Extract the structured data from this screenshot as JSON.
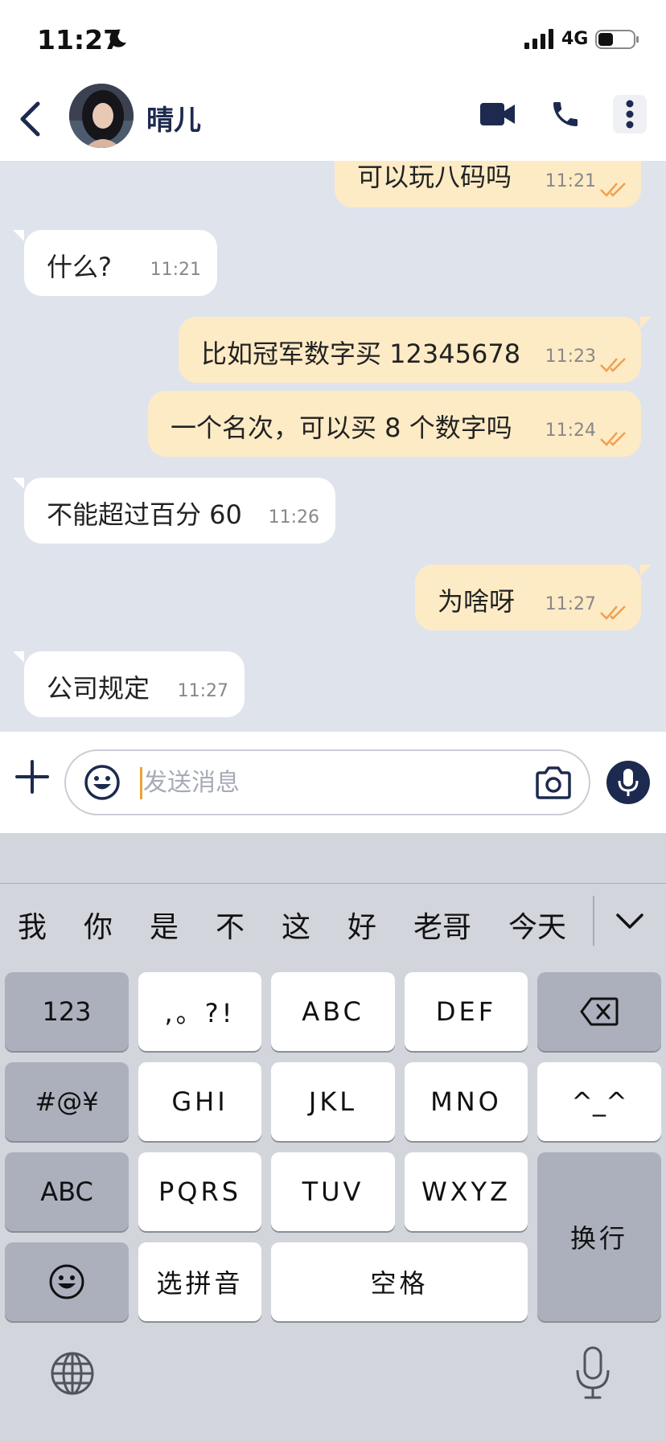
{
  "status_bar": {
    "time": "11:27",
    "network": "4G"
  },
  "header": {
    "contact_name": "晴儿"
  },
  "messages": [
    {
      "dir": "out",
      "text": "可以玩八码吗",
      "time": "11:21",
      "read": true
    },
    {
      "dir": "in",
      "text": "什么?",
      "time": "11:21"
    },
    {
      "dir": "out",
      "text": "比如冠军数字买 12345678",
      "time": "11:23",
      "read": true
    },
    {
      "dir": "out",
      "text": "一个名次，可以买 8 个数字吗",
      "time": "11:24",
      "read": true
    },
    {
      "dir": "in",
      "text": "不能超过百分 60",
      "time": "11:26"
    },
    {
      "dir": "out",
      "text": "为啥呀",
      "time": "11:27",
      "read": true
    },
    {
      "dir": "in",
      "text": "公司规定",
      "time": "11:27"
    }
  ],
  "composer": {
    "placeholder": "发送消息",
    "value": ""
  },
  "keyboard": {
    "candidates": [
      "我",
      "你",
      "是",
      "不",
      "这",
      "好",
      "老哥",
      "今天"
    ],
    "keys": {
      "num": "123",
      "punct": ",。?!",
      "abc": "ABC",
      "def": "DEF",
      "symbols": "#@¥",
      "ghi": "GHI",
      "jkl": "JKL",
      "mno": "MNO",
      "face": "^_^",
      "abc_mode": "ABC",
      "pqrs": "PQRS",
      "tuv": "TUV",
      "wxyz": "WXYZ",
      "return": "换行",
      "pinyin": "选拼音",
      "space": "空格"
    }
  },
  "colors": {
    "outgoing_bubble": "#fdebc6",
    "incoming_bubble": "#ffffff",
    "accent_navy": "#1d2a4f",
    "read_tick": "#f0a050"
  }
}
